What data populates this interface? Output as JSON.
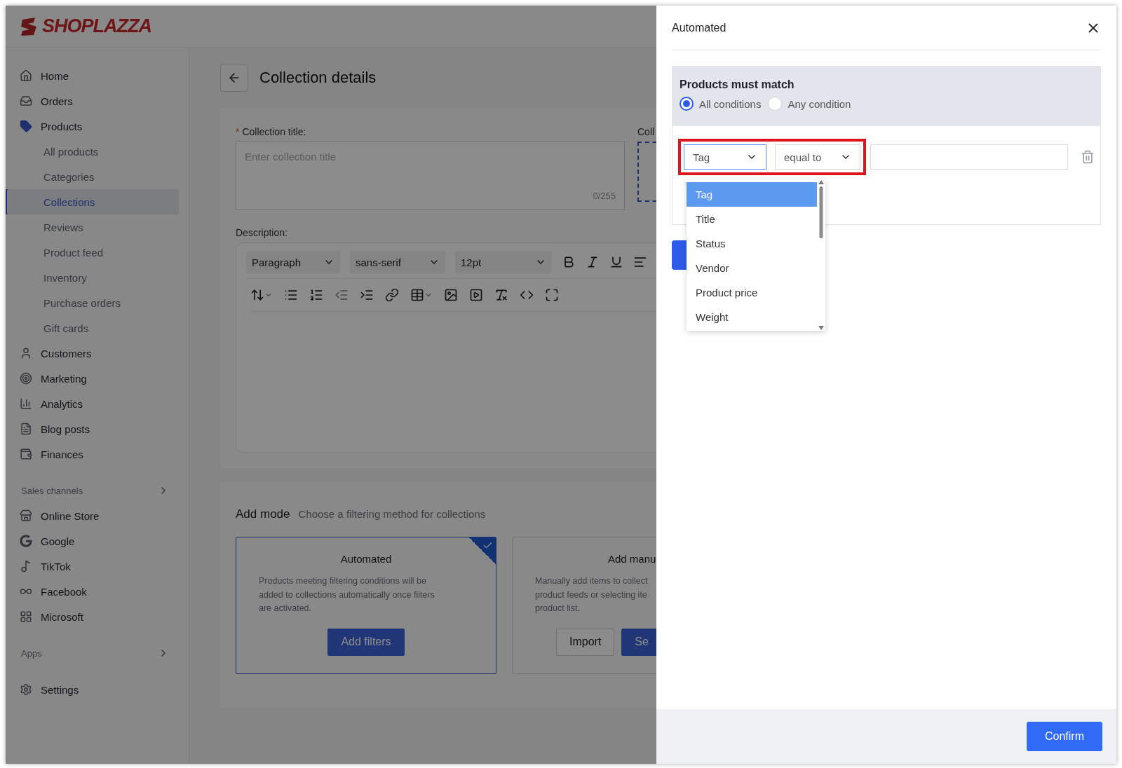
{
  "logo": {
    "text": "SHOPLAZZA"
  },
  "sidebar": {
    "items": [
      {
        "label": "Home",
        "selected": false
      },
      {
        "label": "Orders",
        "selected": false
      },
      {
        "label": "Products",
        "selected": true,
        "children": [
          {
            "label": "All products",
            "selected": false
          },
          {
            "label": "Categories",
            "selected": false
          },
          {
            "label": "Collections",
            "selected": true
          },
          {
            "label": "Reviews",
            "selected": false
          },
          {
            "label": "Product feed",
            "selected": false
          },
          {
            "label": "Inventory",
            "selected": false
          },
          {
            "label": "Purchase orders",
            "selected": false
          },
          {
            "label": "Gift cards",
            "selected": false
          }
        ]
      },
      {
        "label": "Customers",
        "selected": false
      },
      {
        "label": "Marketing",
        "selected": false
      },
      {
        "label": "Analytics",
        "selected": false
      },
      {
        "label": "Blog posts",
        "selected": false
      },
      {
        "label": "Finances",
        "selected": false
      }
    ],
    "sales_channels": {
      "title": "Sales channels",
      "items": [
        {
          "label": "Online Store",
          "selected": false
        },
        {
          "label": "Google",
          "selected": false
        },
        {
          "label": "TikTok",
          "selected": false
        },
        {
          "label": "Facebook",
          "selected": false
        },
        {
          "label": "Microsoft",
          "selected": false
        }
      ]
    },
    "apps": {
      "title": "Apps"
    },
    "settings": {
      "label": "Settings",
      "selected": false
    }
  },
  "page": {
    "title": "Collection details",
    "form": {
      "title_label": "Collection title:",
      "required_mark": "*",
      "title_placeholder": "Enter collection title",
      "title_counter": "0/255",
      "side_label": "Coll",
      "description_label": "Description:",
      "editor": {
        "block_format": "Paragraph",
        "font_family": "sans-serif",
        "font_size": "12pt"
      }
    },
    "add_mode": {
      "title": "Add mode",
      "hint": "Choose a filtering method for collections",
      "options": [
        {
          "title": "Automated",
          "selected": true,
          "description_lines": [
            "Products meeting filtering conditions will be",
            "added to collections automatically once filters",
            "are activated."
          ],
          "buttons": [
            {
              "label": "Add filters",
              "primary": true
            }
          ]
        },
        {
          "title": "Add manu",
          "selected": false,
          "description_lines": [
            "Manually add items to collect",
            "product feeds or selecting ite",
            "product list."
          ],
          "buttons": [
            {
              "label": "Import",
              "primary": false
            },
            {
              "label": "Se",
              "primary": true
            }
          ]
        }
      ]
    }
  },
  "drawer": {
    "title": "Automated",
    "match": {
      "title": "Products must match",
      "options": [
        {
          "label": "All conditions",
          "selected": true
        },
        {
          "label": "Any condition",
          "selected": false
        }
      ]
    },
    "conditions": [
      {
        "field": "Tag",
        "operator": "equal to",
        "highlighted": true
      }
    ],
    "field_menu": {
      "options": [
        {
          "label": "Tag",
          "selected": true
        },
        {
          "label": "Title",
          "selected": false
        },
        {
          "label": "Status",
          "selected": false
        },
        {
          "label": "Vendor",
          "selected": false
        },
        {
          "label": "Product price",
          "selected": false
        },
        {
          "label": "Weight",
          "selected": false
        }
      ]
    },
    "confirm": "Confirm"
  }
}
